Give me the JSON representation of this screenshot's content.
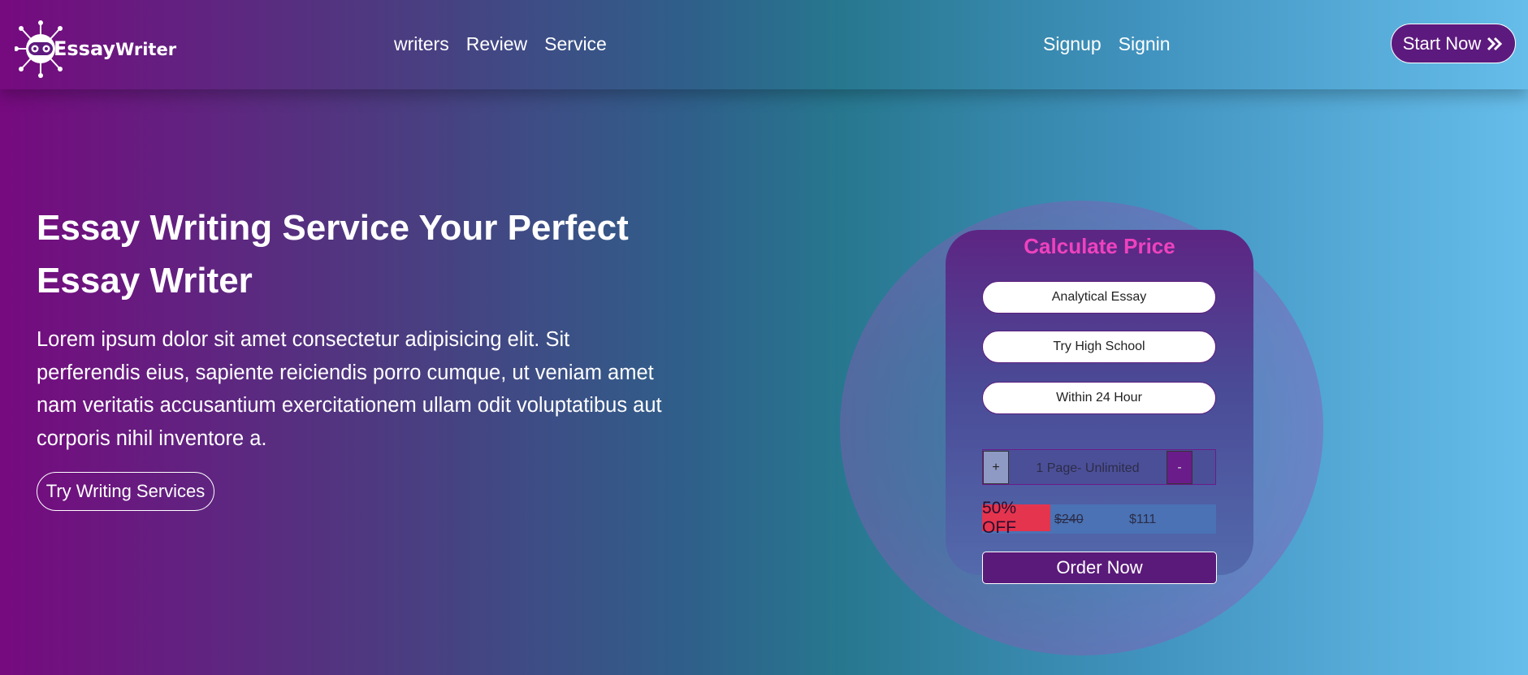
{
  "brand": {
    "logo_big": "Essay",
    "logo_small": "Writer"
  },
  "nav": {
    "left_links": [
      "writers",
      "Review",
      "Service"
    ],
    "right_links": [
      "Signup",
      "Signin"
    ],
    "cta_label": "Start Now",
    "cta_icon": "double-chevron-right-icon"
  },
  "hero": {
    "title": "Essay Writing Service Your Perfect Essay Writer",
    "text": "Lorem ipsum dolor sit amet consectetur adipisicing elit. Sit perferendis eius, sapiente reiciendis porro cumque, ut veniam amet nam veritatis accusantium exercitationem ullam odit voluptatibus aut corporis nihil inventore a.",
    "button_label": "Try Writing Services"
  },
  "calculator": {
    "title": "Calculate Price",
    "essay_type": "Analytical Essay",
    "level": "Try High School",
    "deadline": "Within 24 Hour",
    "plus_label": "+",
    "minus_label": "-",
    "pages_label": "1 Page- Unlimited",
    "discount_label": "50% OFF",
    "old_price": "$240",
    "new_price": "$111",
    "order_label": "Order Now"
  },
  "colors": {
    "accent": "#5a1a7a",
    "title_pink": "#ef42be",
    "discount_red": "#e5344e"
  }
}
